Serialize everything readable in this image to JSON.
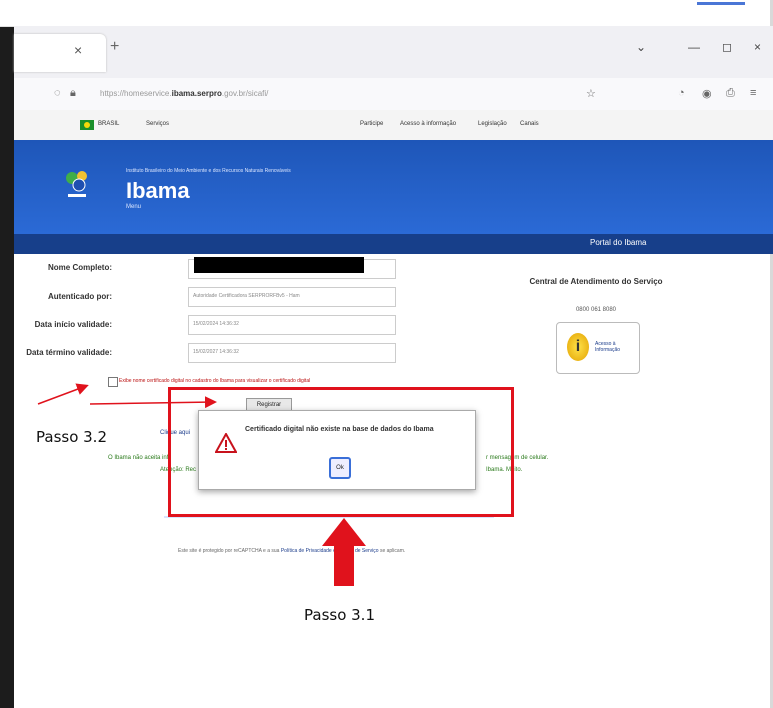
{
  "browser": {
    "url_prefix": "https://homeservice.",
    "url_domain": "ibama.serpro",
    "url_suffix": ".gov.br/sicafi/",
    "tab_close": "×",
    "new_tab": "+",
    "win_min": "—",
    "win_max": "◻",
    "win_close": "×"
  },
  "govbar": {
    "brasil": "BRASIL",
    "servicos": "Serviços",
    "links": [
      "Participe",
      "Acesso à informação",
      "Legislação",
      "Canais"
    ]
  },
  "header": {
    "institute": "Instituto Brasileiro do Meio Ambiente e dos Recursos Naturais Renováveis",
    "brand": "Ibama",
    "sub": "Menu",
    "portal": "Portal do Ibama"
  },
  "form": {
    "fields": [
      {
        "label": "Nome Completo:",
        "value": ""
      },
      {
        "label": "Autenticado por:",
        "value": "Autoridade Certificadora SERPRORFBv5 - Ham"
      },
      {
        "label": "Data início validade:",
        "value": "15/02/2024 14:36:32"
      },
      {
        "label": "Data término validade:",
        "value": "15/02/2027 14:36:32"
      }
    ],
    "checkbox_text": "Exibe nome certificado digital no cadastro do Ibama para visualizar o certificado digital",
    "register_button": "Registrar",
    "link_text": "Clique aqui",
    "green_line1": "O Ibama não aceita inf",
    "green_line1b": "r mensagem de celular.",
    "green_line2": "Atenção: Rec",
    "green_line2b": "Ibama. Muito.",
    "footer": "Este site é protegido por reCAPTCHA e a sua",
    "footer_links": "Política de Privacidade e Termos de Serviço",
    "footer_end": "se aplicam."
  },
  "sidebar": {
    "title": "Central de Atendimento do Serviço",
    "phone": "0800 061 8080",
    "info_label": "Acesso à Informação",
    "info_letter": "i"
  },
  "dialog": {
    "message": "Certificado digital não existe na base de dados do Ibama",
    "ok": "Ok"
  },
  "annotations": {
    "passo_32": "Passo 3.2",
    "passo_31": "Passo 3.1",
    "highlight_color": "#e0121c"
  }
}
